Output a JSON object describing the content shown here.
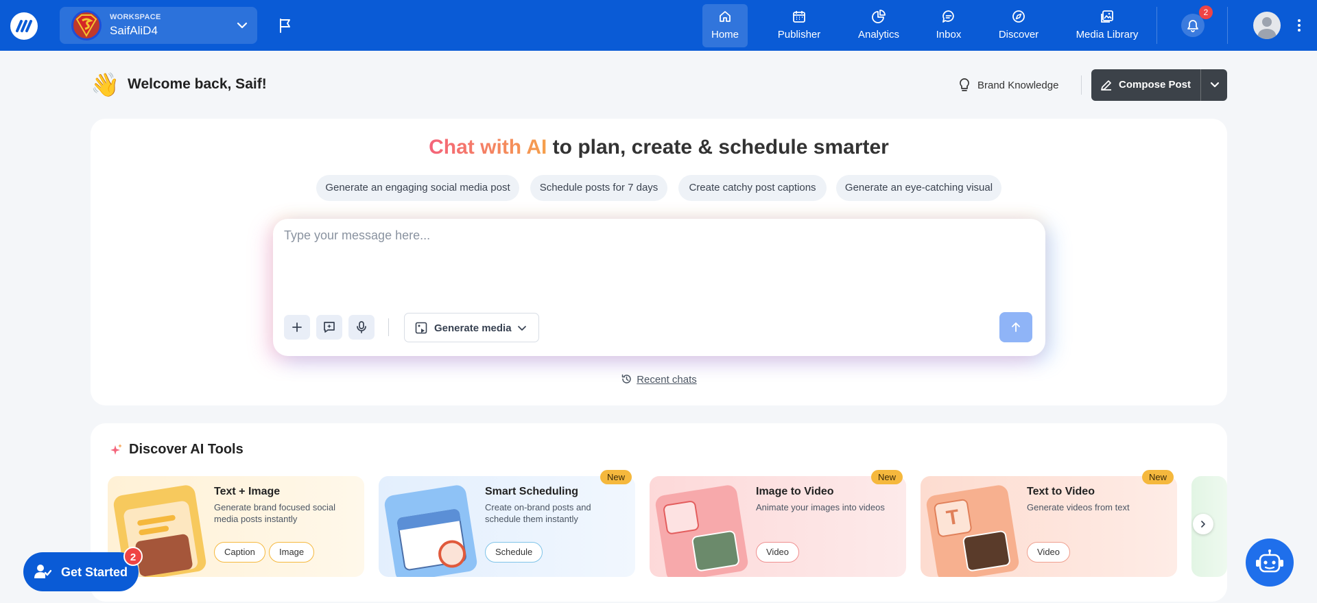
{
  "app": {
    "workspace_label": "WORKSPACE",
    "workspace_name": "SaifAliD4",
    "brand_color": "#0a5bd6"
  },
  "nav": [
    {
      "label": "Home",
      "icon": "home-icon",
      "active": true
    },
    {
      "label": "Publisher",
      "icon": "calendar-icon"
    },
    {
      "label": "Analytics",
      "icon": "pie-chart-icon"
    },
    {
      "label": "Inbox",
      "icon": "chat-bubble-icon"
    },
    {
      "label": "Discover",
      "icon": "compass-icon"
    },
    {
      "label": "Media Library",
      "icon": "image-gallery-icon"
    }
  ],
  "notifications": {
    "count": "2"
  },
  "welcome": {
    "text": "Welcome back, Saif!",
    "brand_knowledge": "Brand Knowledge",
    "compose": "Compose Post"
  },
  "chat": {
    "headline_highlight": "Chat with AI",
    "headline_rest": " to plan, create & schedule smarter",
    "suggestions": [
      "Generate an engaging social media post",
      "Schedule posts for 7 days",
      "Create catchy post captions",
      "Generate an eye-catching visual"
    ],
    "placeholder": "Type your message here...",
    "generate_media": "Generate media",
    "recent_chats": "Recent chats"
  },
  "tools": {
    "title": "Discover AI Tools",
    "new_label": "New",
    "items": [
      {
        "title": "Text + Image",
        "desc": "Generate brand focused social media posts instantly",
        "tags": [
          "Caption",
          "Image"
        ],
        "new": false,
        "bg": "#fff4de"
      },
      {
        "title": "Smart Scheduling",
        "desc": "Create on-brand posts and schedule them instantly",
        "tags": [
          "Schedule"
        ],
        "new": true,
        "bg": "#e8f2fd"
      },
      {
        "title": "Image to Video",
        "desc": "Animate your images into videos",
        "tags": [
          "Video"
        ],
        "new": true,
        "bg": "#fde2e2"
      },
      {
        "title": "Text to Video",
        "desc": "Generate videos from text",
        "tags": [
          "Video"
        ],
        "new": true,
        "bg": "#fde4dd"
      }
    ]
  },
  "get_started": {
    "label": "Get Started",
    "badge": "2"
  }
}
